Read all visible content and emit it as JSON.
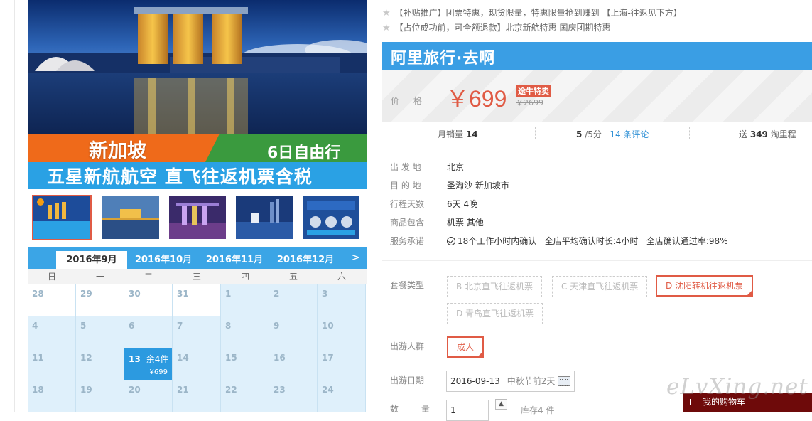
{
  "hero": {
    "title": "新加坡",
    "days": "6日自由行",
    "subtitle": "五星新航航空 直飞往返机票含税"
  },
  "promos": [
    "【补贴推广】团票特惠，现货限量，特惠限量抢到赚到 【上海-往返见下方】",
    "【占位成功前，可全额退款】北京新航特惠 国庆团期特惠"
  ],
  "brand": "阿里旅行·去啊",
  "price": {
    "label": "价 格",
    "value": "￥699",
    "badge": "途牛特卖",
    "original": "￥2699"
  },
  "stats": {
    "monthly_label": "月销量",
    "monthly_value": "14",
    "rating_value": "5",
    "rating_suffix": "/5分",
    "reviews": "14 条评论",
    "points_prefix": "送",
    "points_value": "349",
    "points_suffix": "淘里程"
  },
  "info": {
    "departure_label": "出 发 地",
    "departure": "北京",
    "destination_label": "目 的 地",
    "destination": "圣淘沙   新加坡市",
    "duration_label": "行程天数",
    "duration": "6天 4晚",
    "includes_label": "商品包含",
    "includes": "机票  其他",
    "service_label": "服务承诺",
    "service_1": "18个工作小时内确认",
    "service_2": "全店平均确认时长:4小时",
    "service_3": "全店确认通过率:98%"
  },
  "package": {
    "label": "套餐类型",
    "options": [
      "B 北京直飞往返机票",
      "C 天津直飞往返机票",
      "D 沈阳转机往返机票",
      "D 青岛直飞往返机票"
    ],
    "selected_index": 2
  },
  "travelers": {
    "label": "出游人群",
    "option": "成人"
  },
  "date": {
    "label": "出游日期",
    "value": "2016-09-13",
    "note": "中秋节前2天"
  },
  "quantity": {
    "label": "数 量",
    "value": "1",
    "up": "▲",
    "stock": "库存4 件"
  },
  "calendar": {
    "months": [
      "2016年9月",
      "2016年10月",
      "2016年11月",
      "2016年12月"
    ],
    "active_month": 0,
    "next": ">",
    "weekdays": [
      "日",
      "一",
      "二",
      "三",
      "四",
      "五",
      "六"
    ],
    "weeks": [
      [
        "28",
        "29",
        "30",
        "31",
        "1",
        "2",
        "3"
      ],
      [
        "4",
        "5",
        "6",
        "7",
        "8",
        "9",
        "10"
      ],
      [
        "11",
        "12",
        "13",
        "14",
        "15",
        "16",
        "17"
      ],
      [
        "18",
        "19",
        "20",
        "21",
        "22",
        "23",
        "24"
      ]
    ],
    "selected": {
      "day": "13",
      "stock": "余4件",
      "price": "¥699"
    }
  },
  "watermark": "eLvXing.net",
  "cart": "我的购物车"
}
